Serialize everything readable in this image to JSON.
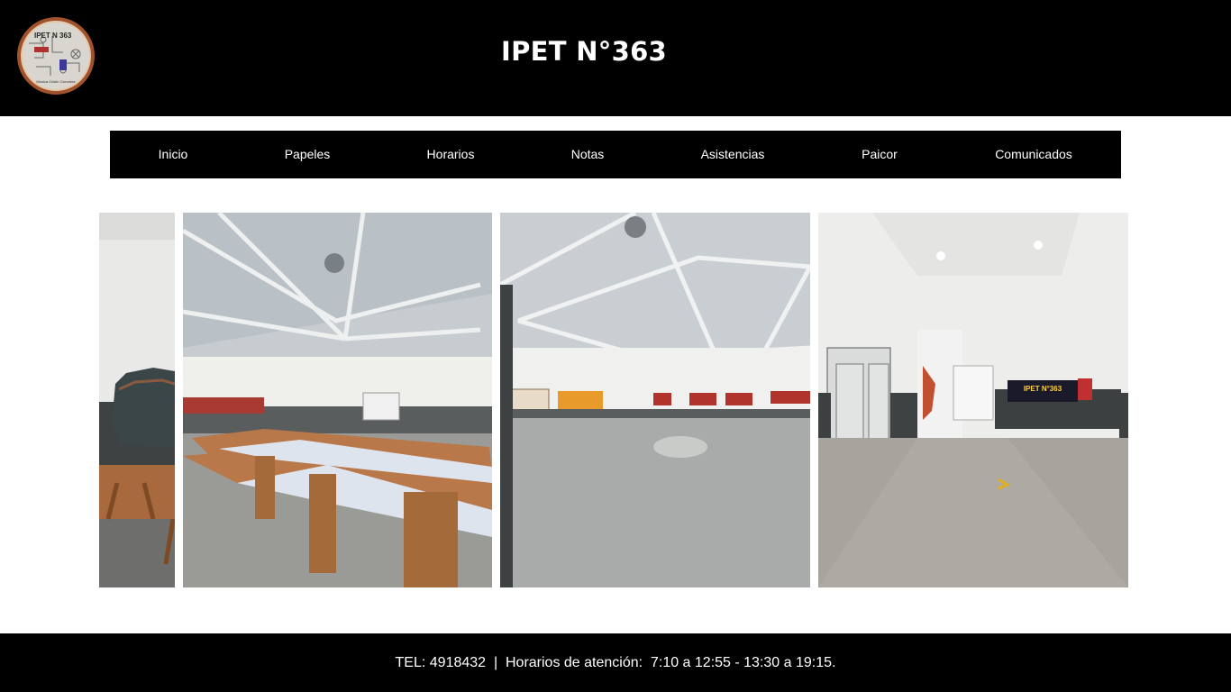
{
  "header": {
    "title": "IPET N°363",
    "logo": {
      "icon": "school-crest-logo",
      "text_top": "IPET N 363",
      "text_bottom": "Monica Cristin Gonzalez"
    }
  },
  "nav": {
    "items": [
      {
        "label": "Inicio"
      },
      {
        "label": "Papeles"
      },
      {
        "label": "Horarios"
      },
      {
        "label": "Notas"
      },
      {
        "label": "Asistencias"
      },
      {
        "label": "Paicor"
      },
      {
        "label": "Comunicados"
      }
    ]
  },
  "gallery": {
    "photos": [
      {
        "subject": "mural-wall"
      },
      {
        "subject": "dining-hall-tables"
      },
      {
        "subject": "dining-hall-open"
      },
      {
        "subject": "school-hallway"
      }
    ],
    "hallway_sign": "IPET N°363"
  },
  "footer": {
    "text": "TEL: 4918432  |  Horarios de atención:  7:10 a 12:55 - 13:30 a 19:15."
  },
  "colors": {
    "header_bg": "#000000",
    "nav_bg": "#000000",
    "footer_bg": "#000000",
    "text": "#ffffff"
  }
}
